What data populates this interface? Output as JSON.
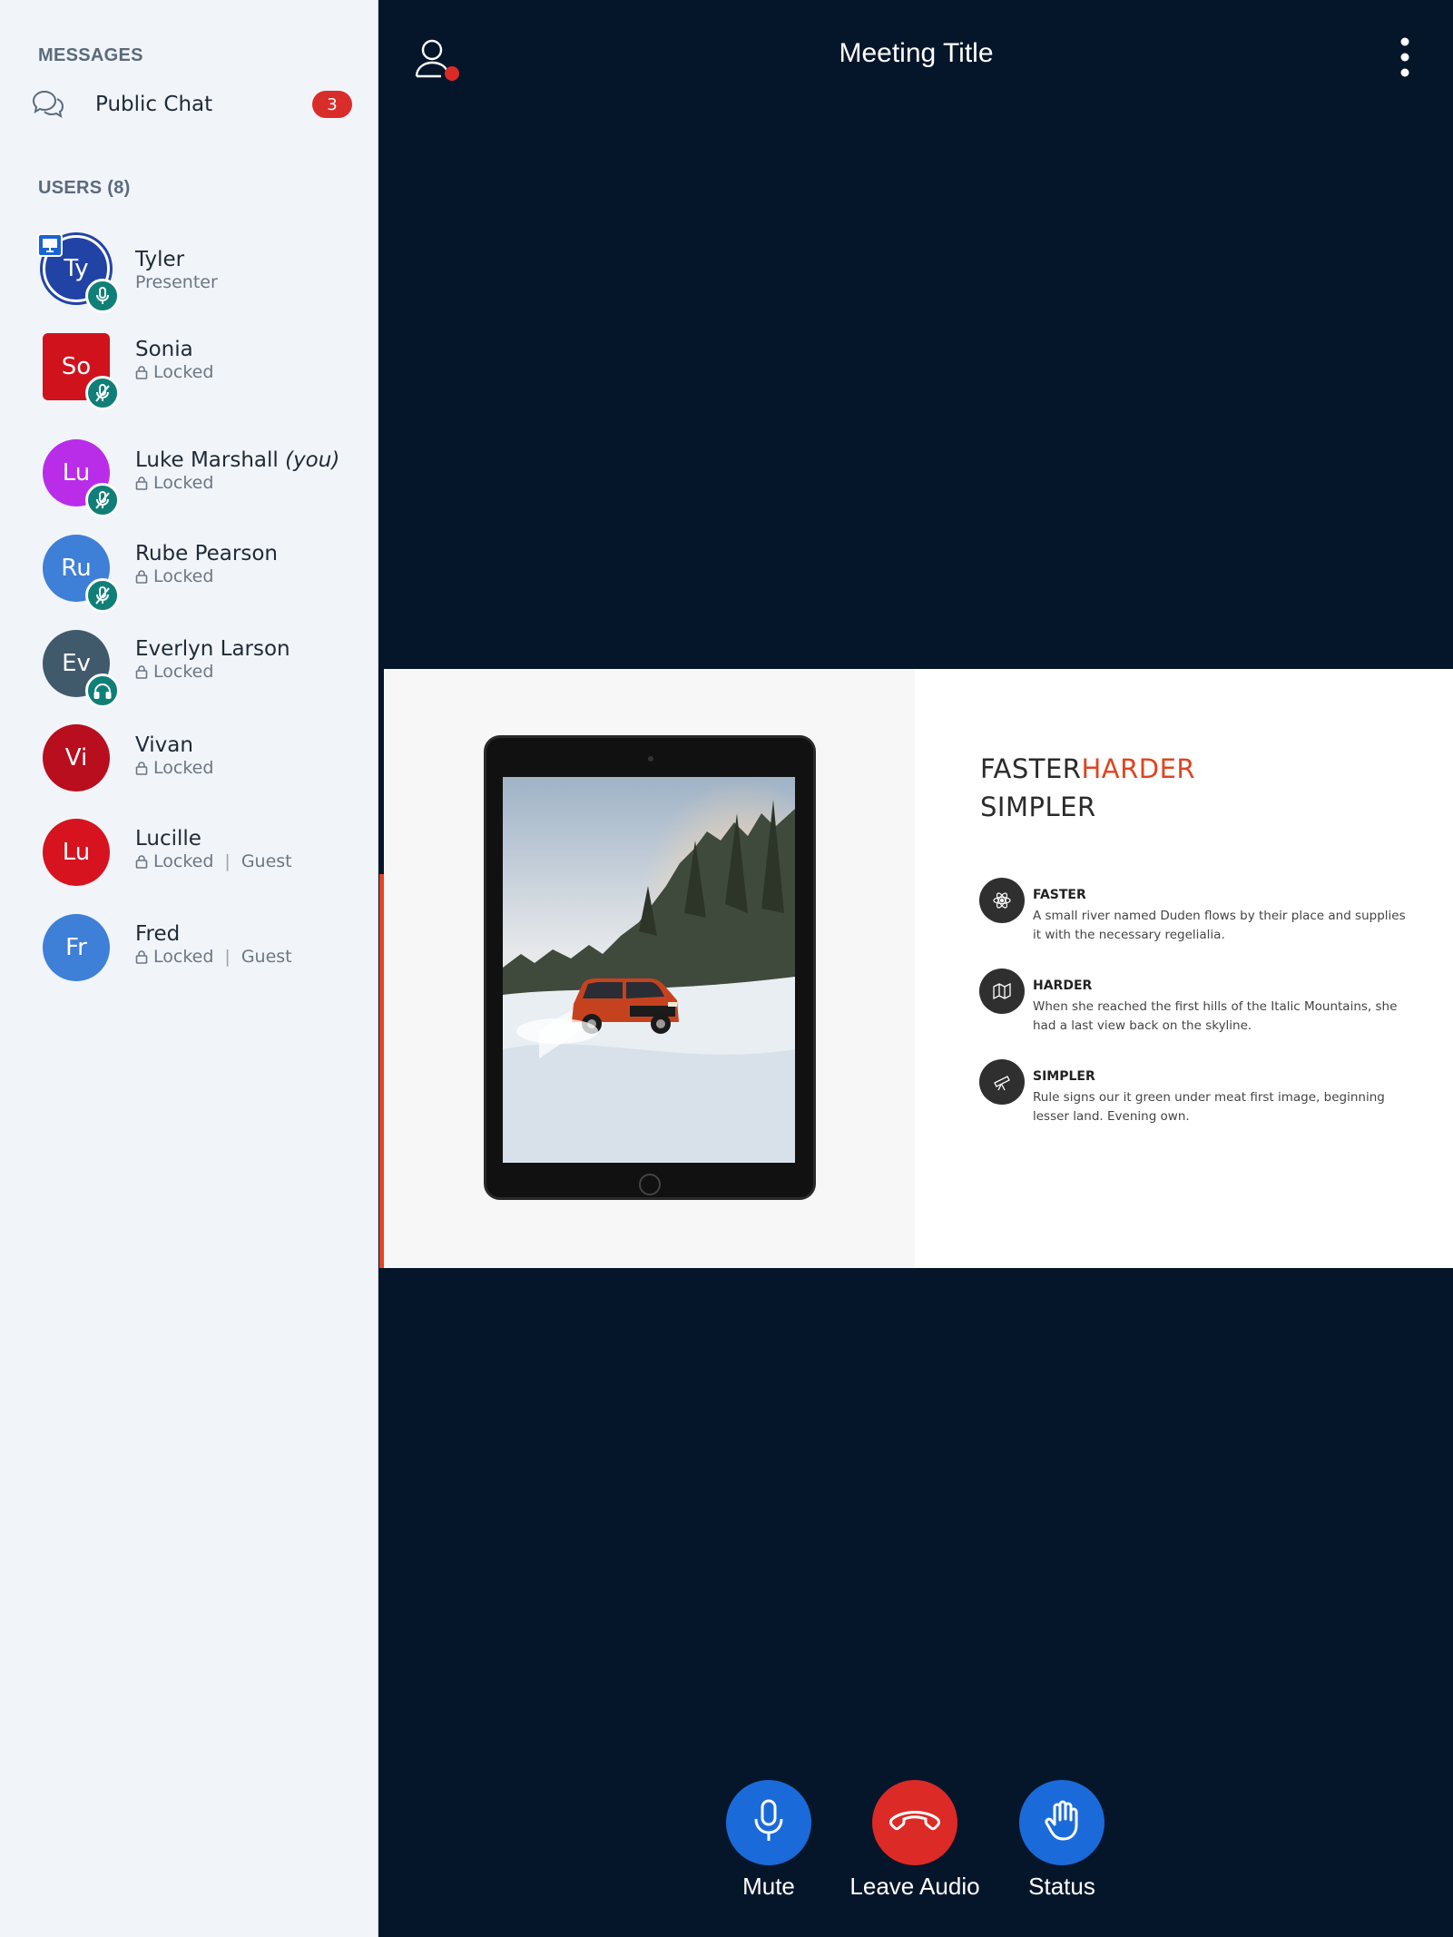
{
  "sidebar": {
    "messages_label": "MESSAGES",
    "public_chat": {
      "label": "Public Chat",
      "unread": "3"
    },
    "users_label": "USERS (8)",
    "users": [
      {
        "initials": "Ty",
        "name": "Tyler",
        "you": "",
        "status": "Presenter",
        "guest": "",
        "color": "#2143a6",
        "voice": "mic-icon"
      },
      {
        "initials": "So",
        "name": "Sonia",
        "you": "",
        "status": "Locked",
        "guest": "",
        "color": "#d0121c",
        "voice": "mic-muted-icon"
      },
      {
        "initials": "Lu",
        "name": "Luke Marshall",
        "you": "(you)",
        "status": "Locked",
        "guest": "",
        "color": "#b92de9",
        "voice": "mic-muted-icon"
      },
      {
        "initials": "Ru",
        "name": "Rube Pearson",
        "you": "",
        "status": "Locked",
        "guest": "",
        "color": "#3e7fd8",
        "voice": "mic-muted-icon"
      },
      {
        "initials": "Ev",
        "name": "Everlyn Larson",
        "you": "",
        "status": "Locked",
        "guest": "",
        "color": "#405a6b",
        "voice": "headphones-icon"
      },
      {
        "initials": "Vi",
        "name": "Vivan",
        "you": "",
        "status": "Locked",
        "guest": "",
        "color": "#b80e1d",
        "voice": ""
      },
      {
        "initials": "Lu",
        "name": "Lucille",
        "you": "",
        "status": "Locked",
        "guest": "Guest",
        "color": "#d6131f",
        "voice": ""
      },
      {
        "initials": "Fr",
        "name": "Fred",
        "you": "",
        "status": "Locked",
        "guest": "Guest",
        "color": "#3e7fd8",
        "voice": ""
      }
    ]
  },
  "header": {
    "title": "Meeting Title",
    "user_icon": "user-icon",
    "menu_icon": "more-vertical-icon"
  },
  "slide": {
    "headline_1a": "FASTER",
    "headline_1b": "HARDER",
    "headline_2": "SIMPLER",
    "features": [
      {
        "title": "FASTER",
        "text": "A small river named Duden flows by their place and supplies it with the necessary regelialia.",
        "icon": "atom-icon"
      },
      {
        "title": "HARDER",
        "text": "When she reached the first hills of the Italic Mountains, she had a last view back on the skyline.",
        "icon": "map-icon"
      },
      {
        "title": "SIMPLER",
        "text": "Rule signs our it green under meat first image, beginning lesser land. Evening own.",
        "icon": "telescope-icon"
      }
    ]
  },
  "controls": {
    "mute": "Mute",
    "leave": "Leave Audio",
    "status": "Status"
  },
  "colors": {
    "main_bg": "#06162a",
    "sidebar_bg": "#f1f4f8",
    "primary": "#1b6ad9",
    "danger": "#dc2a27",
    "accent": "#e0441f"
  }
}
